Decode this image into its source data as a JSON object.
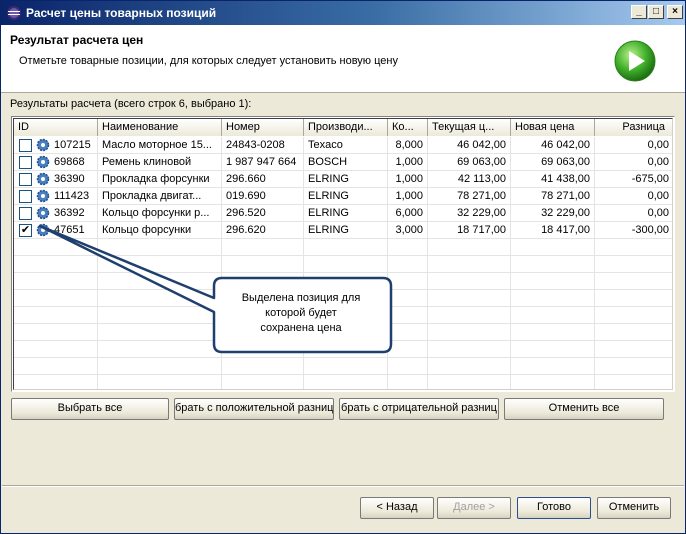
{
  "window": {
    "title": "Расчет цены товарных позиций"
  },
  "header": {
    "title": "Результат расчета цен",
    "description": "Отметьте товарные позиции, для которых следует установить новую цену"
  },
  "results_label": "Результаты расчета (всего строк 6, выбрано 1):",
  "table": {
    "columns": [
      "ID",
      "Наименование",
      "Номер",
      "Производи...",
      "Ко...",
      "Текущая ц...",
      "Новая цена",
      "Разница"
    ],
    "rows": [
      {
        "checked": false,
        "id": "107215",
        "name": "Масло моторное 15...",
        "number": "24843-0208",
        "maker": "Texaco",
        "qty": "8,000",
        "current": "46 042,00",
        "new": "46 042,00",
        "diff": "0,00"
      },
      {
        "checked": false,
        "id": "69868",
        "name": "Ремень клиновой",
        "number": "1 987 947 664",
        "maker": "BOSCH",
        "qty": "1,000",
        "current": "69 063,00",
        "new": "69 063,00",
        "diff": "0,00"
      },
      {
        "checked": false,
        "id": "36390",
        "name": "Прокладка форсунки",
        "number": "296.660",
        "maker": "ELRING",
        "qty": "1,000",
        "current": "42 113,00",
        "new": "41 438,00",
        "diff": "-675,00"
      },
      {
        "checked": false,
        "id": "111423",
        "name": "Прокладка двигат...",
        "number": "019.690",
        "maker": "ELRING",
        "qty": "1,000",
        "current": "78 271,00",
        "new": "78 271,00",
        "diff": "0,00"
      },
      {
        "checked": false,
        "id": "36392",
        "name": "Кольцо форсунки р...",
        "number": "296.520",
        "maker": "ELRING",
        "qty": "6,000",
        "current": "32 229,00",
        "new": "32 229,00",
        "diff": "0,00"
      },
      {
        "checked": true,
        "id": "47651",
        "name": "Кольцо форсунки",
        "number": "296.620",
        "maker": "ELRING",
        "qty": "3,000",
        "current": "18 717,00",
        "new": "18 417,00",
        "diff": "-300,00"
      }
    ]
  },
  "selection_buttons": {
    "select_all": "Выбрать все",
    "select_positive": "брать с положительной разниц",
    "select_negative": "брать с отрицательной разниц",
    "deselect_all": "Отменить все"
  },
  "callout": {
    "line1": "Выделена позиция для",
    "line2": "которой будет",
    "line3": "сохранена цена"
  },
  "nav_buttons": {
    "back": "< Назад",
    "next": "Далее >",
    "finish": "Готово",
    "cancel": "Отменить"
  },
  "icons": {
    "app": "eclipse-icon",
    "go": "green-play-icon",
    "row": "gear-icon"
  }
}
